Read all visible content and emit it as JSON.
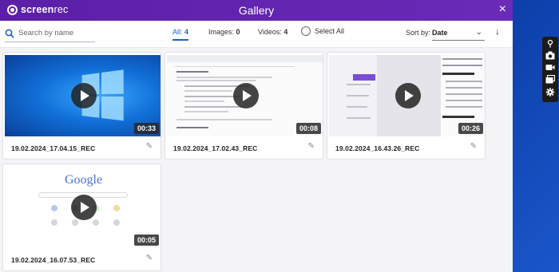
{
  "window": {
    "title": "Gallery",
    "logo_bold": "screen",
    "logo_thin": "rec",
    "close_icon": "×"
  },
  "toolbar": {
    "search_placeholder": "Search by name",
    "filters": [
      {
        "label": "All:",
        "count": "4",
        "active": true
      },
      {
        "label": "Images:",
        "count": "0",
        "active": false
      },
      {
        "label": "Videos:",
        "count": "4",
        "active": false
      }
    ],
    "select_all": "Select All",
    "sort_label": "Sort by:",
    "sort_value": "Date",
    "sort_direction_icon": "↓"
  },
  "recordings": [
    {
      "name": "19.02.2024_17.04.15_REC",
      "duration": "00:33",
      "thumb": "windows-desktop"
    },
    {
      "name": "19.02.2024_17.02.43_REC",
      "duration": "00:08",
      "thumb": "search-results"
    },
    {
      "name": "19.02.2024_16.43.26_REC",
      "duration": "00:26",
      "thumb": "document-page"
    },
    {
      "name": "19.02.2024_16.07.53_REC",
      "duration": "00:05",
      "thumb": "google-homepage"
    }
  ],
  "thumb_text": {
    "google_logo": "Google"
  },
  "side_panel": {
    "icons": [
      "pin-icon",
      "camera-icon",
      "video-icon",
      "gallery-icon",
      "gear-icon"
    ]
  },
  "colors": {
    "titlebar": "#5b1fa6",
    "accent": "#1f5fd0",
    "desktop": "#1c5fd6"
  }
}
